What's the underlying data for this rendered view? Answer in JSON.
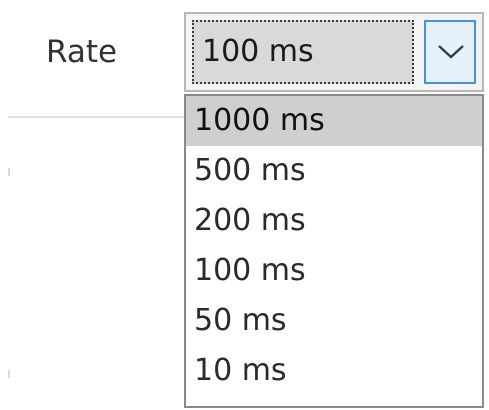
{
  "rate": {
    "label": "Rate",
    "selected_value": "100 ms",
    "options": [
      "1000 ms",
      "500 ms",
      "200 ms",
      "100 ms",
      "50 ms",
      "10 ms"
    ],
    "highlighted_option": "1000 ms",
    "dropdown_icon": "chevron-down-icon"
  }
}
